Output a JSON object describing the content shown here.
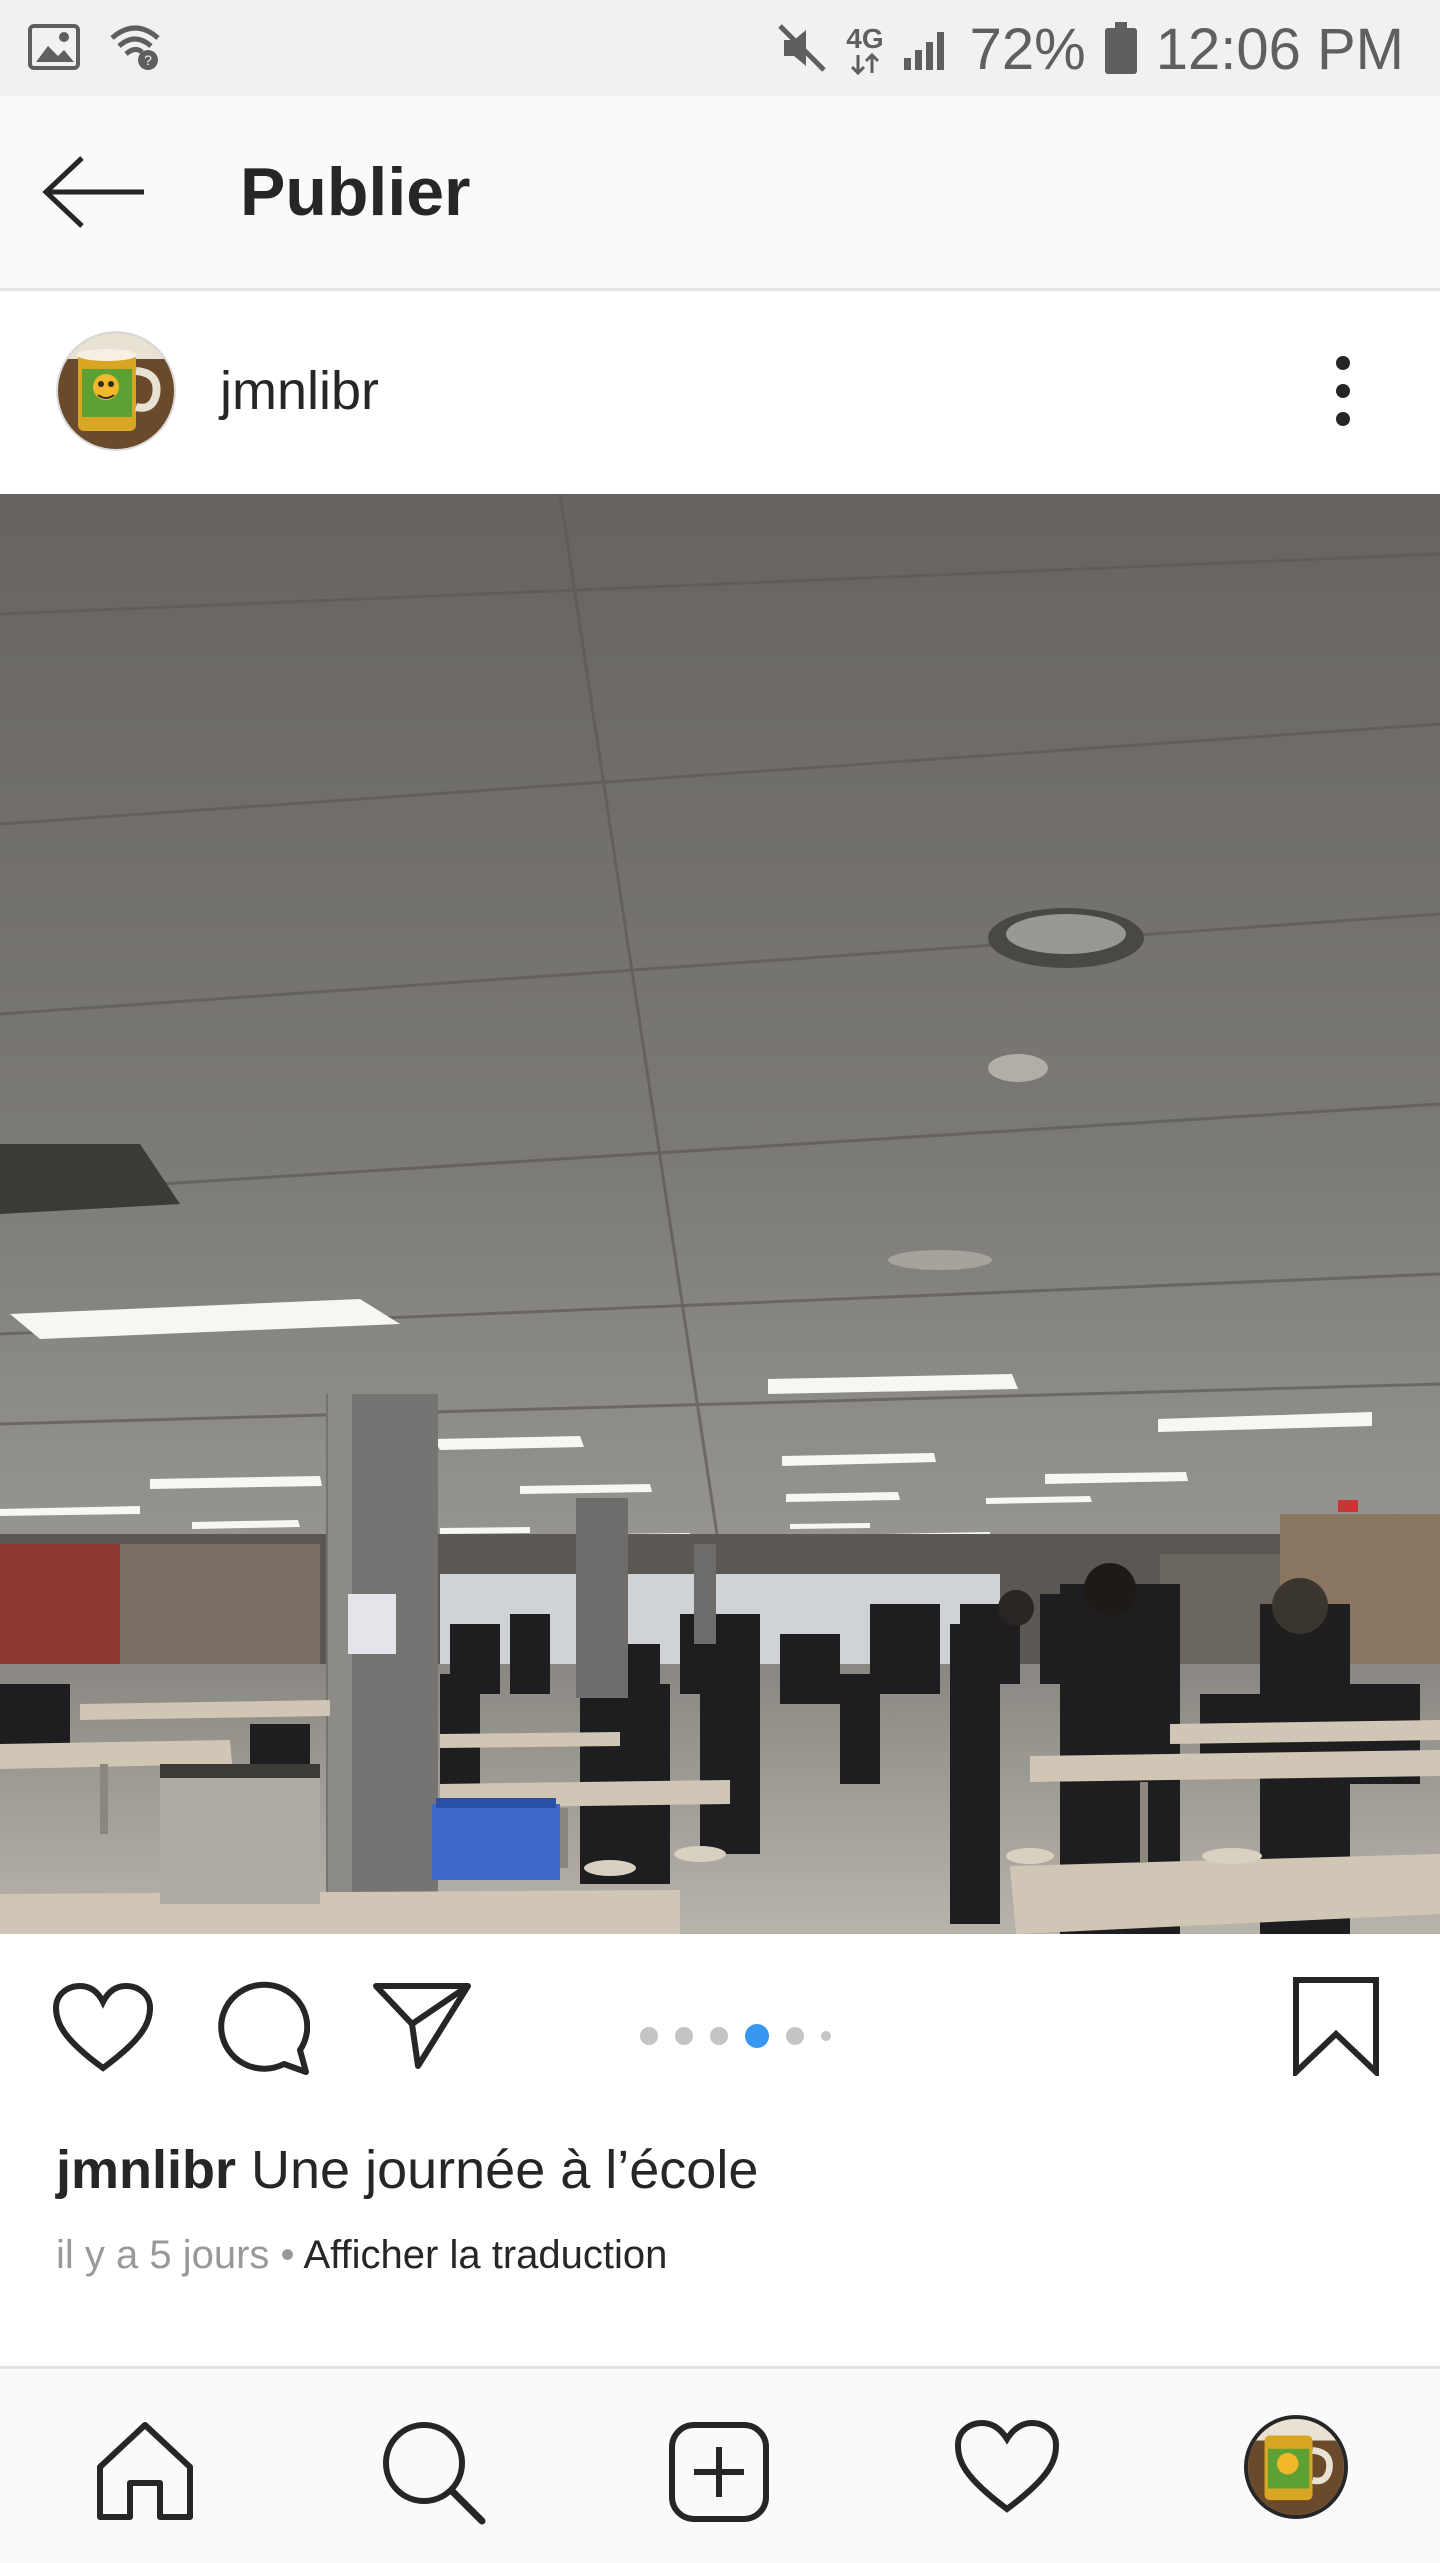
{
  "status_bar": {
    "battery": "72%",
    "time": "12:06 PM",
    "network": "4G",
    "icons": [
      "gallery-icon",
      "wifi-call-icon",
      "mute-icon",
      "signal-icon",
      "battery-icon"
    ]
  },
  "header": {
    "title": "Publier",
    "back_icon": "arrow-left-icon"
  },
  "post": {
    "username": "jmnlibr",
    "avatar_icon": "mug-avatar",
    "more_icon": "vertical-dots-icon",
    "image_icon": "cafeteria-photo",
    "carousel": {
      "count": 6,
      "active": 4
    },
    "actions": [
      "like-icon",
      "comment-icon",
      "share-icon",
      "bookmark-icon"
    ],
    "caption_user": "jmnlibr",
    "caption_text": "Une journée à l’école",
    "time_ago": "il y a 5 jours",
    "separator": "•",
    "translate_label": "Afficher la traduction"
  },
  "bottom_nav": {
    "items": [
      "home-icon",
      "search-icon",
      "add-post-icon",
      "activity-heart-icon",
      "profile-avatar"
    ]
  },
  "colors": {
    "accent": "#3897f0",
    "text": "#262626",
    "muted": "#999999",
    "statusbar_bg": "#f1f1f1",
    "bar_bg": "#fafafa"
  }
}
